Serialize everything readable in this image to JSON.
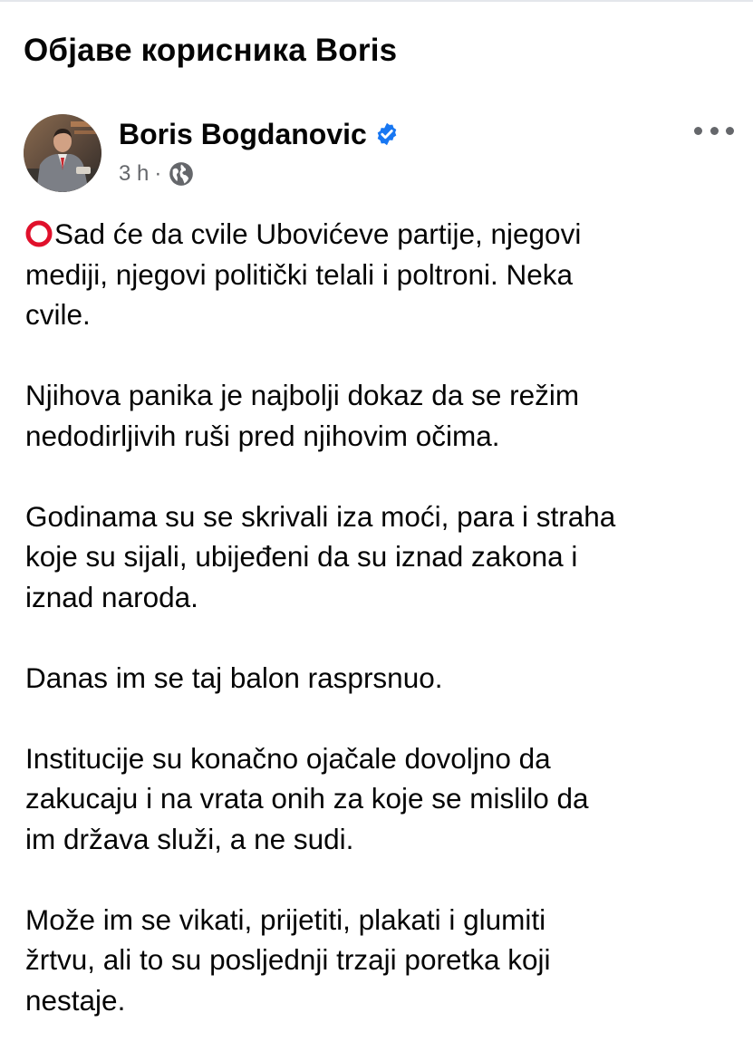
{
  "header": {
    "title": "Објаве корисника Boris"
  },
  "post": {
    "author": "Boris Bogdanovic",
    "verified": true,
    "time": "3 h",
    "separator": "·",
    "audience_icon": "globe-icon",
    "more_icon": "more-horizontal-icon",
    "avatar_icon": "profile-photo",
    "lead_emoji": "hollow-red-circle-icon",
    "paragraphs": [
      {
        "lines": [
          "Sad će da cvile Ubovićeve partije, njegovi",
          "mediji, njegovi politički telali i poltroni. Neka",
          "cvile."
        ]
      },
      {
        "lines": [
          "Njihova panika je najbolji dokaz da se režim",
          "nedodirljivih ruši pred njihovim očima."
        ]
      },
      {
        "lines": [
          "Godinama su se skrivali iza moći, para i straha",
          "koje su sijali, ubijeđeni da su iznad zakona i",
          "iznad naroda."
        ]
      },
      {
        "lines": [
          "Danas im se taj balon rasprsnuo."
        ]
      },
      {
        "lines": [
          "Institucije su konačno ojačale dovoljno da",
          "zakucaju i na vrata onih za koje se mislilo da",
          "im država služi, a ne sudi."
        ]
      },
      {
        "lines": [
          "Može im se vikati, prijetiti, plakati i glumiti",
          "žrtvu, ali to su posljednji trzaji poretka koji",
          "nestaje."
        ]
      }
    ]
  },
  "colors": {
    "text": "#050505",
    "secondary": "#65676b",
    "verified_blue": "#1877f2",
    "emoji_red": "#e0102b"
  }
}
